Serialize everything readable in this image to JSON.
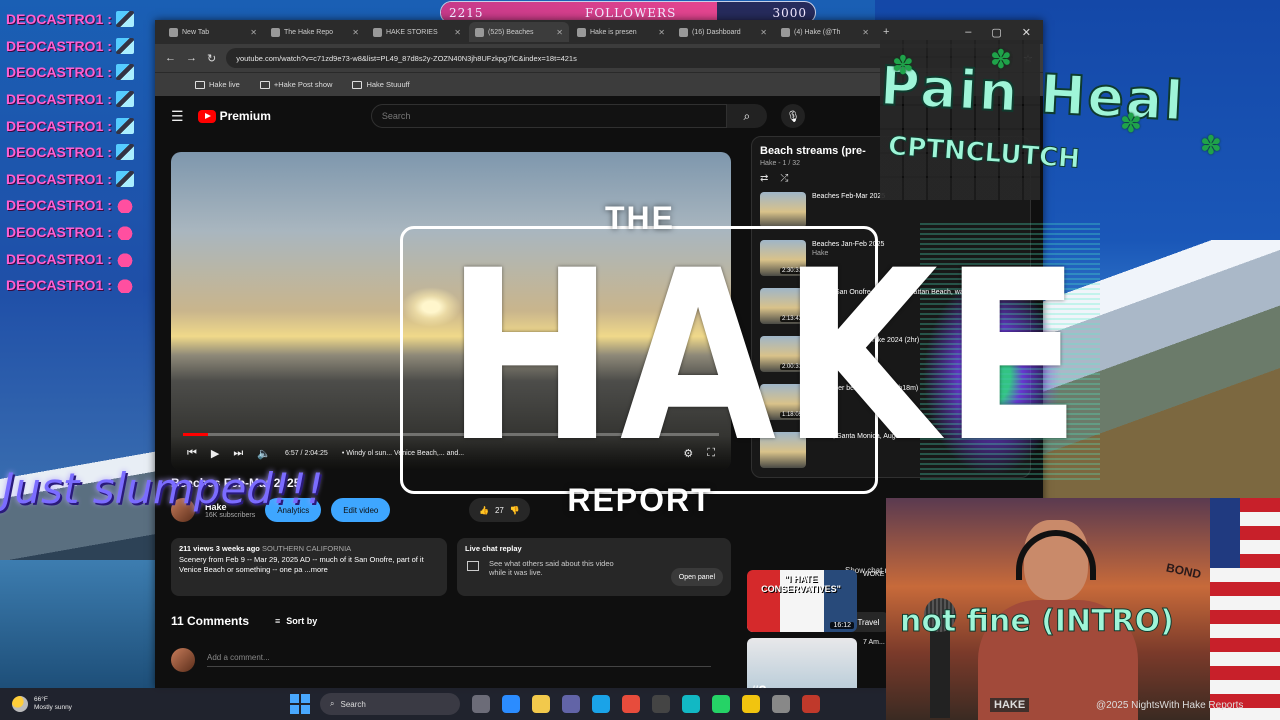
{
  "chat": {
    "username": "DEOCASTRO1",
    "separator": ":",
    "messages": [
      {
        "emote": "pixel-emote"
      },
      {
        "emote": "pixel-emote"
      },
      {
        "emote": "pixel-emote"
      },
      {
        "emote": "pixel-emote"
      },
      {
        "emote": "pixel-emote"
      },
      {
        "emote": "pixel-emote"
      },
      {
        "emote": "pixel-emote"
      },
      {
        "emote": "heart-emote"
      },
      {
        "emote": "heart-emote"
      },
      {
        "emote": "heart-emote"
      },
      {
        "emote": "heart-emote"
      }
    ]
  },
  "followers": {
    "current": "2215",
    "label": "FOLLOWERS",
    "goal": "3000",
    "progress_fraction": 0.738
  },
  "browser": {
    "tabs": [
      {
        "label": "New Tab"
      },
      {
        "label": "The Hake Repo"
      },
      {
        "label": "HAKE STORIES"
      },
      {
        "label": "(525) Beaches"
      },
      {
        "label": "Hake is presen"
      },
      {
        "label": "(16) Dashboard"
      },
      {
        "label": "(4) Hake (@Th"
      }
    ],
    "active_tab_index": 3,
    "new_tab_glyph": "+",
    "url": "youtube.com/watch?v=c71zd9e73-w8&list=PL49_87d8s2y-ZOZN40N3jh8UFzkpg7lC&index=18t=421s",
    "bookmarks": [
      {
        "label": "Hake live"
      },
      {
        "label": "+Hake Post show"
      },
      {
        "label": "Hake Stuuuff"
      }
    ]
  },
  "youtube": {
    "logo": "Premium",
    "search_placeholder": "Search",
    "player": {
      "time": "6:57 / 2:04:25",
      "chapter": "• Windy ol sun... Venice Beach,... and..."
    },
    "video_title": "Beaches Feb-Mar 2025",
    "channel": {
      "name": "Hake",
      "subscribers": "16K subscribers"
    },
    "buttons": {
      "analytics": "Analytics",
      "edit_video": "Edit video",
      "likes": "27"
    },
    "description": {
      "meta": "211 views  3 weeks ago",
      "location": "SOUTHERN CALIFORNIA",
      "text": "Scenery from Feb 9 -- Mar 29, 2025 AD -- much of it San Onofre, part of it Venice Beach or something -- one pa",
      "more": "...more"
    },
    "live_chat": {
      "title": "Live chat replay",
      "body": "See what others said about this video while it was live.",
      "button": "Open panel"
    },
    "comments": {
      "count": "11 Comments",
      "sort": "Sort by",
      "placeholder": "Add a comment..."
    },
    "playlist": {
      "title": "Beach streams (pre-",
      "sub": "Hake - 1 / 32",
      "items": [
        {
          "title": "Beaches Feb-Mar 2025",
          "channel": "",
          "duration": ""
        },
        {
          "title": "Beaches Jan-Feb 2025",
          "channel": "Hake",
          "duration": "2:30:31"
        },
        {
          "title": "Lots of San Onofre, rest of Manhattan Beach, walks",
          "channel": "Hake",
          "duration": "2:13:43"
        },
        {
          "title": "Mt Baldy, NYE day hike 2024 (2hr)",
          "channel": "Hake",
          "duration": "2:00:31"
        },
        {
          "title": "December beaches 2024 (1h18m)",
          "channel": "Hake",
          "duration": "1:18:05"
        },
        {
          "title": "Venice, Santa Monica, August",
          "channel": "",
          "duration": ""
        }
      ]
    },
    "show_chat": "Show chat replay",
    "chips": [
      "All",
      "From Hake",
      "Travel"
    ],
    "recommendations": [
      {
        "caption": "\"I HATE CONSERVATIVES\"",
        "duration": "16:12",
        "title": "WOKE Jesu...",
        "number": ""
      },
      {
        "caption": "",
        "duration": "",
        "title": "7 Am... Deer...",
        "number": "#3"
      }
    ]
  },
  "overlay": {
    "logo_the": "THE",
    "logo_hake": "HAKE",
    "logo_report": "REPORT",
    "slumped": "Just slumped!!!",
    "pain_heal": "Pain Heal",
    "username_banner": "CPTNCLUTCH",
    "not_fine": "not fine (INTRO)",
    "watermark": "@2025 NightsWith Hake Reports",
    "mic_sign": "HAKE",
    "flag_text": "BOND"
  },
  "taskbar": {
    "temperature": "66°F",
    "condition": "Mostly sunny",
    "search": "Search"
  },
  "colors": {
    "chat_name": "#ff5fd0",
    "followers_fill": "#e4458f",
    "youtube_red": "#ff0000",
    "accent_blue": "#3ea6ff",
    "neon_green": "#9ff5d8",
    "slumped_purple": "#7b6cff"
  }
}
